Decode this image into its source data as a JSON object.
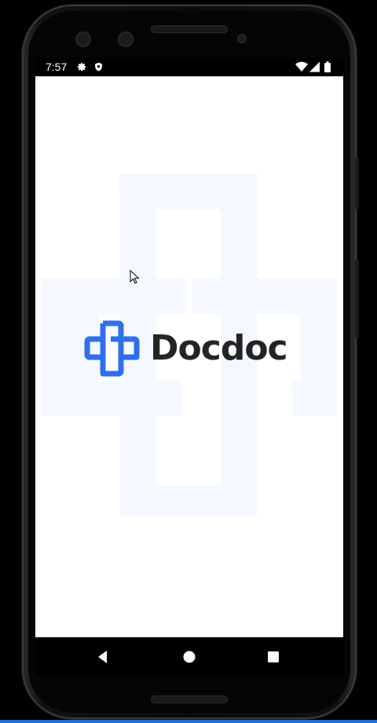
{
  "status_bar": {
    "time": "7:57",
    "left_icons": [
      "gear-icon",
      "shield-icon"
    ],
    "right_icons": [
      "wifi-icon",
      "signal-icon",
      "battery-icon"
    ]
  },
  "splash": {
    "app_name": "Docdoc",
    "logo_icon": "medical-cross-logo-icon",
    "brand_color": "#2F6FED",
    "watermark_color": "#F5F8FF"
  },
  "nav_bar": {
    "buttons": [
      "back-icon",
      "home-icon",
      "recents-icon"
    ]
  }
}
